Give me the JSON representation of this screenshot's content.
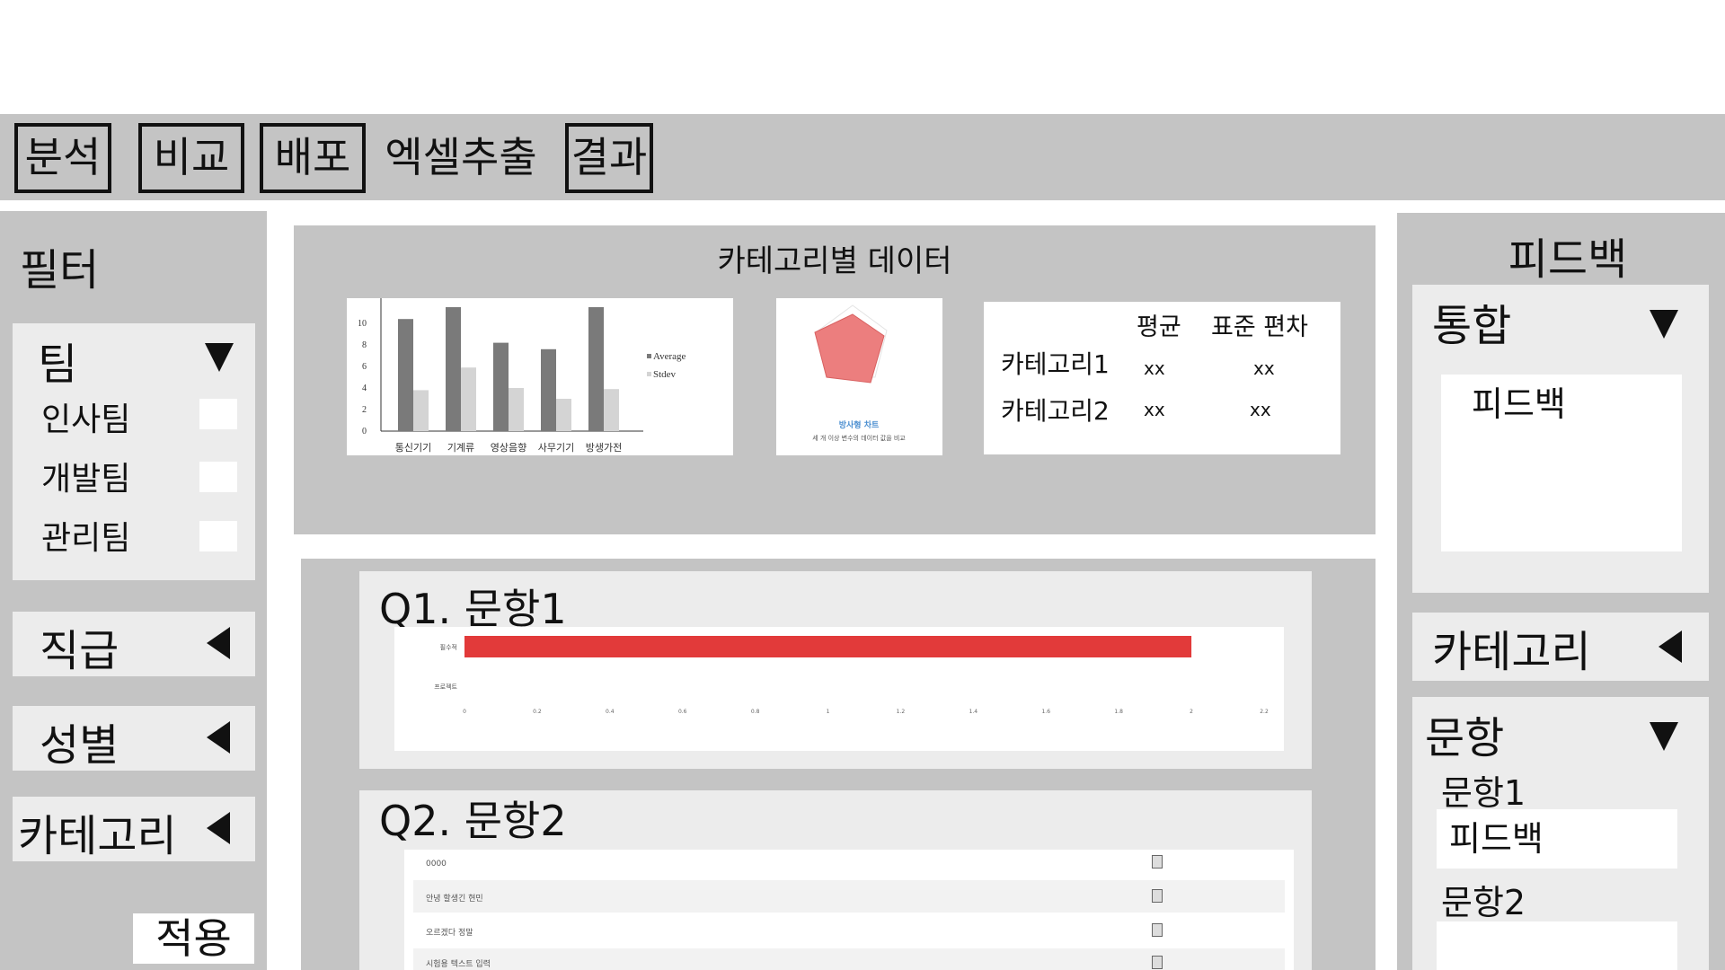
{
  "nav": {
    "tabs": [
      {
        "label": "분석",
        "boxed": true
      },
      {
        "label": "비교",
        "boxed": true
      },
      {
        "label": "배포",
        "boxed": true
      },
      {
        "label": "엑셀추출",
        "boxed": false
      },
      {
        "label": "결과",
        "boxed": true
      }
    ]
  },
  "filter": {
    "title": "필터",
    "team": {
      "label": "팀",
      "options": [
        "인사팀",
        "개발팀",
        "관리팀"
      ]
    },
    "collapsed": [
      "직급",
      "성별",
      "카테고리"
    ],
    "apply_label": "적용"
  },
  "category_panel": {
    "title": "카테고리별 데이터",
    "bar_chart": {
      "legend": [
        "Average",
        "Stdev"
      ],
      "y_ticks": [
        "10",
        "8",
        "6",
        "4",
        "2",
        "0"
      ],
      "x_labels": [
        "통신기기",
        "기계류",
        "영상음향",
        "사무기기",
        "방생가전"
      ]
    },
    "radar": {
      "title": "방사형 차트",
      "caption": "세 개 이상 변수의 데이터 값을 비교"
    },
    "table": {
      "headers": [
        "평균",
        "표준 편차"
      ],
      "rows": [
        {
          "name": "카테고리1",
          "avg": "xx",
          "sd": "xx"
        },
        {
          "name": "카테고리2",
          "avg": "xx",
          "sd": "xx"
        }
      ]
    }
  },
  "chart_data": [
    {
      "type": "bar",
      "categories": [
        "통신기기",
        "기계류",
        "영상음향",
        "사무기기",
        "방생가전"
      ],
      "series": [
        {
          "name": "Average",
          "values": [
            10.4,
            12.8,
            8.2,
            7.6,
            12.6
          ]
        },
        {
          "name": "Stdev",
          "values": [
            3.8,
            5.9,
            4.0,
            3.0,
            3.9
          ]
        }
      ],
      "ylim": [
        0,
        11.5
      ],
      "y_ticks": [
        0,
        2,
        4,
        6,
        8,
        10
      ],
      "legend": "right",
      "colors": [
        "#7a7a7a",
        "#d4d4d4"
      ]
    },
    {
      "type": "bar",
      "orientation": "horizontal",
      "categories": [
        "필수적",
        "프로젝트"
      ],
      "values": [
        2,
        0
      ],
      "xlim": [
        0,
        2.2
      ],
      "x_ticks": [
        "0",
        "0.2",
        "0.4",
        "0.6",
        "0.8",
        "1",
        "1.2",
        "1.4",
        "1.6",
        "1.8",
        "2",
        "2.2"
      ],
      "colors": [
        "#e23a3a"
      ]
    }
  ],
  "questions": [
    {
      "label": "Q1. 문항1"
    },
    {
      "label": "Q2. 문항2",
      "rows": [
        "0000",
        "안녕 할생긴 현민",
        "오르겠다 정말",
        "시험용 텍스트 입력"
      ]
    }
  ],
  "feedback": {
    "title": "피드백",
    "integrated": {
      "label": "통합",
      "box_text": "피드백"
    },
    "category_label": "카테고리",
    "question": {
      "label": "문항",
      "items": [
        {
          "label": "문항1",
          "box_text": "피드백"
        },
        {
          "label": "문항2",
          "box_text": ""
        }
      ]
    }
  },
  "colors": {
    "grey": "#c4c4c4",
    "light": "#ececec",
    "accent_red": "#e23a3a",
    "bar_dark": "#7a7a7a",
    "bar_light": "#d4d4d4"
  }
}
